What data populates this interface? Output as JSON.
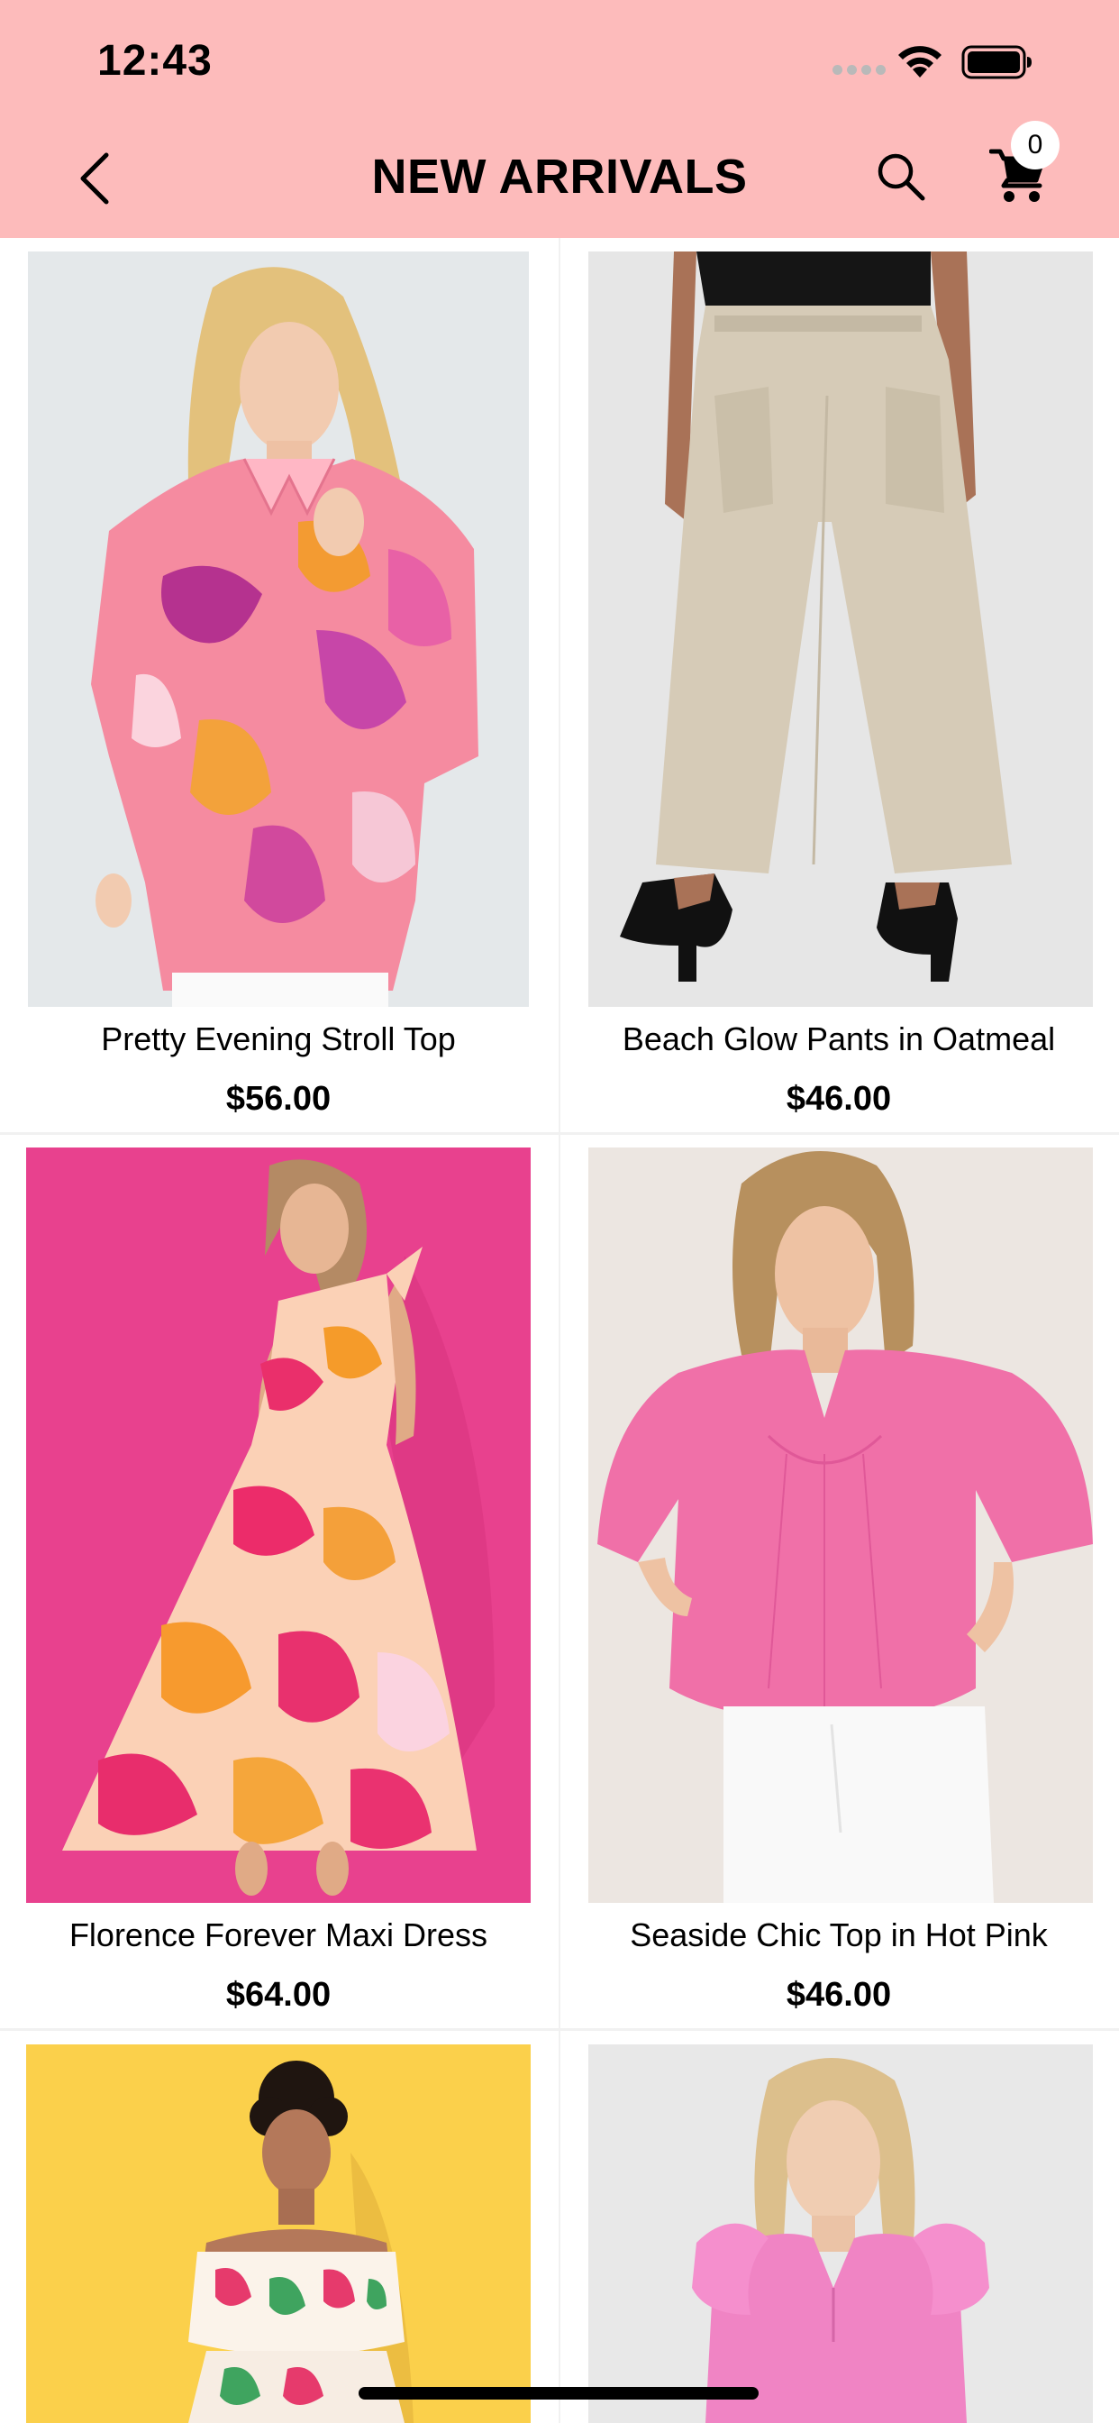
{
  "status_bar": {
    "time": "12:43"
  },
  "header": {
    "title": "NEW ARRIVALS",
    "cart_count": "0",
    "icons": [
      "chevron-left-icon",
      "search-icon",
      "cart-icon"
    ]
  },
  "colors": {
    "header_bg": "#fdbbbb",
    "text": "#000000",
    "divider": "#f1f1f1"
  },
  "products": [
    {
      "name": "Pretty Evening Stroll Top",
      "price": "$56.00"
    },
    {
      "name": "Beach Glow Pants in Oatmeal",
      "price": "$46.00"
    },
    {
      "name": "Florence Forever Maxi Dress",
      "price": "$64.00"
    },
    {
      "name": "Seaside Chic Top in Hot Pink",
      "price": "$46.00"
    },
    {
      "name": "",
      "price": ""
    },
    {
      "name": "",
      "price": ""
    }
  ]
}
